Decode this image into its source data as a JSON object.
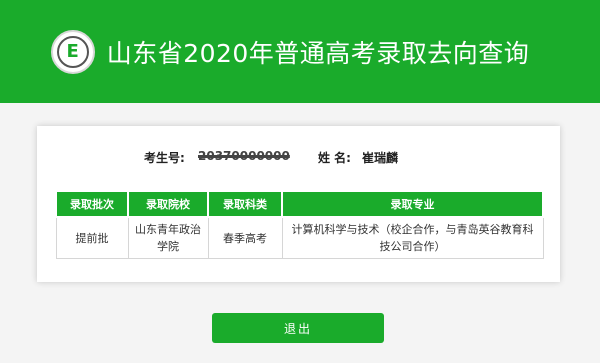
{
  "header": {
    "title": "山东省2020年普通高考录取去向查询",
    "logo_icon": "school-emblem",
    "logo_letter": "E",
    "accent_color": "#1aab2b"
  },
  "student": {
    "id_label": "考生号:",
    "id_value": "20370000000",
    "name_label": "姓 名:",
    "name_value": "崔瑞麟"
  },
  "table": {
    "headers": [
      "录取批次",
      "录取院校",
      "录取科类",
      "录取专业"
    ],
    "rows": [
      [
        "提前批",
        "山东青年政治学院",
        "春季高考",
        "计算机科学与技术（校企合作，与青岛英谷教育科技公司合作）"
      ]
    ]
  },
  "actions": {
    "exit_label": "退出"
  }
}
